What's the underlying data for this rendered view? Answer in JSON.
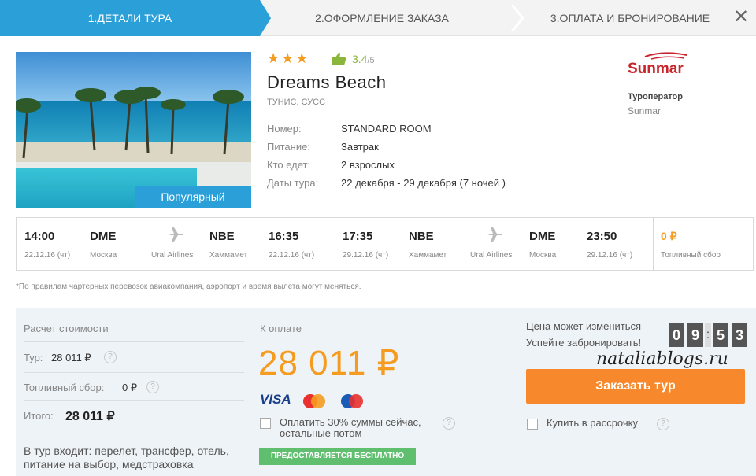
{
  "steps": [
    {
      "label": "1.ДЕТАЛИ ТУРА",
      "active": true
    },
    {
      "label": "2.ОФОРМЛЕНИЕ ЗАКАЗА",
      "active": false
    },
    {
      "label": "3.ОПЛАТА И БРОНИРОВАНИЕ",
      "active": false
    }
  ],
  "close_symbol": "✕",
  "hotel": {
    "badge": "Популярный",
    "stars": "★★★",
    "rating": "3.4",
    "rating_max": "/5",
    "name": "Dreams Beach",
    "location": "ТУНИС, СУСС",
    "details": [
      {
        "label": "Номер:",
        "value": "STANDARD ROOM"
      },
      {
        "label": "Питание:",
        "value": "Завтрак"
      },
      {
        "label": "Кто едет:",
        "value": "2 взрослых"
      },
      {
        "label": "Даты тура:",
        "value": "22 декабря - 29 декабря (7 ночей )"
      }
    ]
  },
  "operator": {
    "logo_text": "Sunmar",
    "label": "Туроператор",
    "name": "Sunmar"
  },
  "flights": {
    "outbound": {
      "dep_time": "14:00",
      "dep_date": "22.12.16 (чт)",
      "dep_code": "DME",
      "dep_city": "Москва",
      "airline": "Ural Airlines",
      "arr_code": "NBE",
      "arr_city": "Хаммамет",
      "arr_time": "16:35",
      "arr_date": "22.12.16 (чт)"
    },
    "return": {
      "dep_time": "17:35",
      "dep_date": "29.12.16 (чт)",
      "dep_code": "NBE",
      "dep_city": "Хаммамет",
      "airline": "Ural Airlines",
      "arr_code": "DME",
      "arr_city": "Москва",
      "arr_time": "23:50",
      "arr_date": "29.12.16 (чт)"
    },
    "fuel_value": "0 ₽",
    "fuel_label": "Топливный сбор"
  },
  "note": "*По правилам чартерных перевозок авиакомпания, аэропорт и время вылета могут меняться.",
  "calc": {
    "title": "Расчет стоимости",
    "tour_label": "Тур:",
    "tour_value": "28 011 ₽",
    "fuel_label": "Топливный сбор:",
    "fuel_value": "0 ₽",
    "total_label": "Итого:",
    "total_value": "28 011 ₽",
    "includes": "В тур входит: перелет, трансфер, отель, питание на выбор, медстраховка"
  },
  "payment": {
    "label": "К оплате",
    "amount": "28 011 ₽",
    "visa": "VISA",
    "partial_text_1": "Оплатить 30% суммы сейчас,",
    "partial_text_2": "остальные потом",
    "free_badge": "ПРЕДОСТАВЛЯЕТСЯ БЕСПЛАТНО"
  },
  "booking": {
    "price_change": "Цена может измениться",
    "hurry": "Успейте забронировать!",
    "timer_digits": [
      "0",
      "9",
      "5",
      "3"
    ],
    "watermark": "nataliablogs.ru",
    "order_button": "Заказать тур",
    "installment": "Купить в рассрочку"
  },
  "colors": {
    "accent_blue": "#2a9fd8",
    "accent_orange": "#f59c20",
    "button_orange": "#f7882b",
    "rating_green": "#8ab63b",
    "badge_green": "#5fbf6f"
  }
}
